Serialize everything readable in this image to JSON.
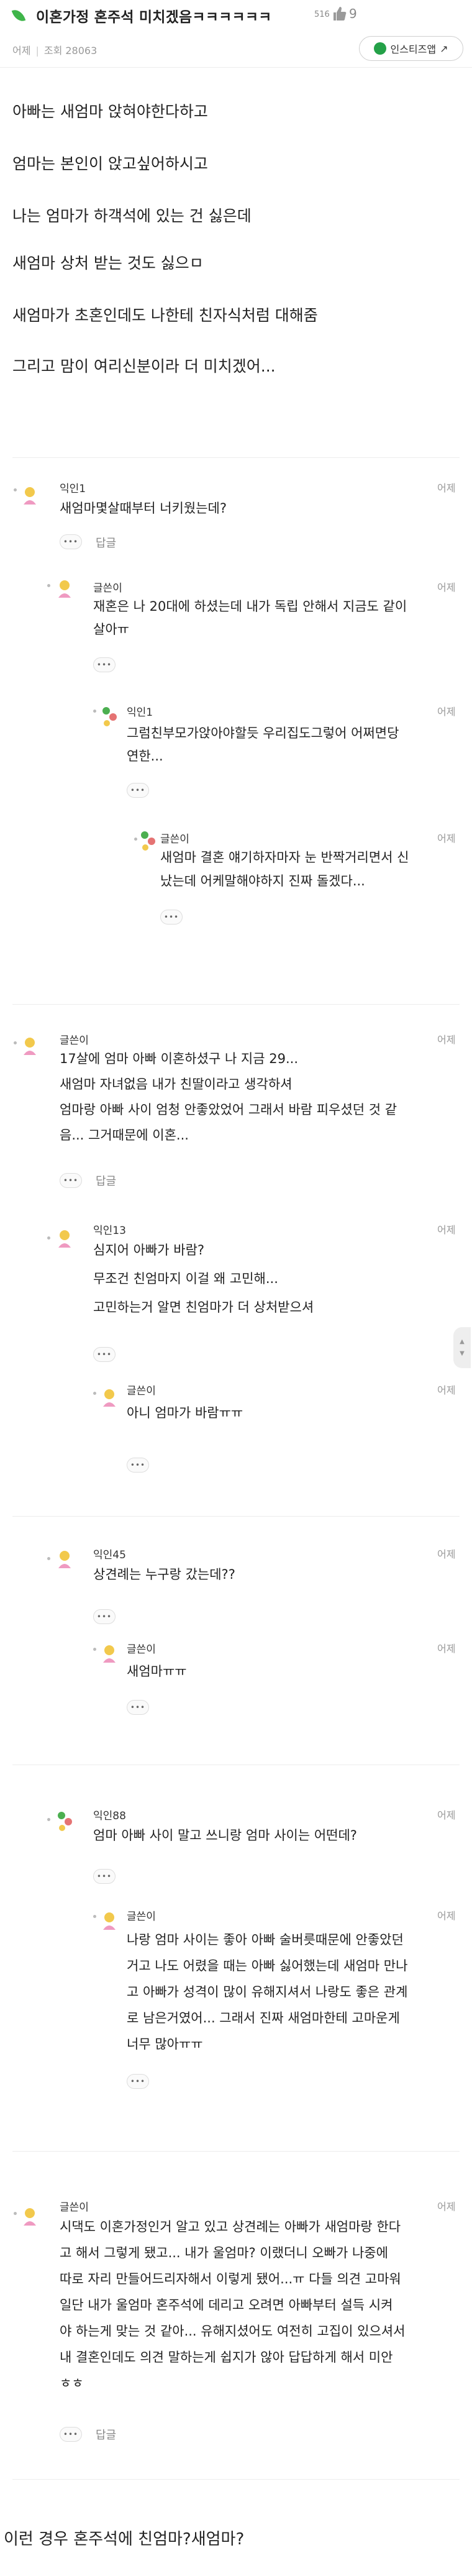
{
  "post": {
    "title": "이혼가정 혼주석 미치겠음ㅋㅋㅋㅋㅋㅋ",
    "view_badge": "516",
    "likes": "9",
    "time": "어제",
    "views": "조회 28063",
    "insta_button": "인스티즈앱",
    "body": [
      "아빠는 새엄마 앉혀야한다하고",
      "엄마는 본인이 앉고싶어하시고",
      "나는 엄마가 하객석에 있는 건 싫은데",
      "새엄마 상처 받는 것도 싫으ㅁ",
      "새엄마가 초혼인데도 나한테 친자식처럼 대해줌",
      "그리고 맘이 여리신분이라 더 미치겠어..."
    ]
  },
  "comments": [
    {
      "author": "익인1",
      "time": "어제",
      "lines": [
        "새엄마몇살때부터 너키웠는데?"
      ],
      "more": "•••",
      "reply": "답글"
    },
    {
      "author": "글쓴이",
      "time": "어제",
      "lines": [
        "재혼은 나 20대에 하셨는데 내가 독립 안해서 지금도 같이",
        "살아ㅠ"
      ],
      "more": "•••"
    },
    {
      "author": "익인1",
      "time": "어제",
      "lines": [
        "그럼친부모가앉아야할듯 우리집도그렇어 어쩌면당",
        "연한..."
      ],
      "more": "•••"
    },
    {
      "author": "글쓴이",
      "time": "어제",
      "lines": [
        "새엄마 결혼 얘기하자마자 눈 반짝거리면서 신",
        "났는데 어케말해야하지 진짜 돌겠다..."
      ],
      "more": "•••"
    },
    {
      "author": "글쓴이",
      "time": "어제",
      "lines": [
        "17살에 엄마 아빠 이혼하셨구 나 지금 29...",
        "새엄마 자녀없음 내가 친딸이라고 생각하셔",
        "엄마랑 아빠 사이 엄청 안좋았었어 그래서 바람 피우셨던 것 같",
        "음... 그거때문에 이혼..."
      ],
      "more": "•••",
      "reply": "답글"
    },
    {
      "author": "익인13",
      "time": "어제",
      "lines": [
        "심지어 아빠가 바람?",
        "무조건 친엄마지 이걸 왜 고민해...",
        "고민하는거 알면 친엄마가 더 상처받으셔"
      ],
      "more": "•••"
    },
    {
      "author": "글쓴이",
      "time": "어제",
      "lines": [
        "아니 엄마가 바람ㅠㅠ"
      ],
      "more": "•••"
    },
    {
      "author": "익인45",
      "time": "어제",
      "lines": [
        "상견례는 누구랑 갔는데??"
      ],
      "more": "•••"
    },
    {
      "author": "글쓴이",
      "time": "어제",
      "lines": [
        "새엄마ㅠㅠ"
      ],
      "more": "•••"
    },
    {
      "author": "익인88",
      "time": "어제",
      "lines": [
        "엄마 아빠 사이 말고 쓰니랑 엄마 사이는 어떤데?"
      ],
      "more": "•••"
    },
    {
      "author": "글쓴이",
      "time": "어제",
      "lines": [
        "나랑 엄마 사이는 좋아 아빠 술버릇때문에 안좋았던",
        "거고 나도 어렸을 때는 아빠 싫어했는데 새엄마 만나",
        "고 아빠가 성격이 많이 유해지셔서 나랑도 좋은 관계",
        "로 남은거였어... 그래서 진짜 새엄마한테 고마운게",
        "너무 많아ㅠㅠ"
      ],
      "more": "•••"
    },
    {
      "author": "글쓴이",
      "time": "어제",
      "lines": [
        "시댁도 이혼가정인거 알고 있고 상견례는 아빠가 새엄마랑 한다",
        "고 해서 그렇게 됐고... 내가 울엄마? 이랬더니 오빠가 나중에",
        "따로 자리 만들어드리자해서 이렇게 됐어...ㅠ 다들 의견 고마워",
        "일단 내가 울엄마 혼주석에 데리고 오려면 아빠부터 설득 시켜",
        "야 하는게 맞는 것 같아... 유해지셨어도 여전히 고집이 있으셔서",
        "내 결혼인데도 의견 말하는게 쉽지가 않아 답답하게 해서 미안",
        "ㅎㅎ"
      ],
      "more": "•••",
      "reply": "답글"
    }
  ],
  "footer_question": "이런 경우 혼주석에 친엄마?새엄마?"
}
